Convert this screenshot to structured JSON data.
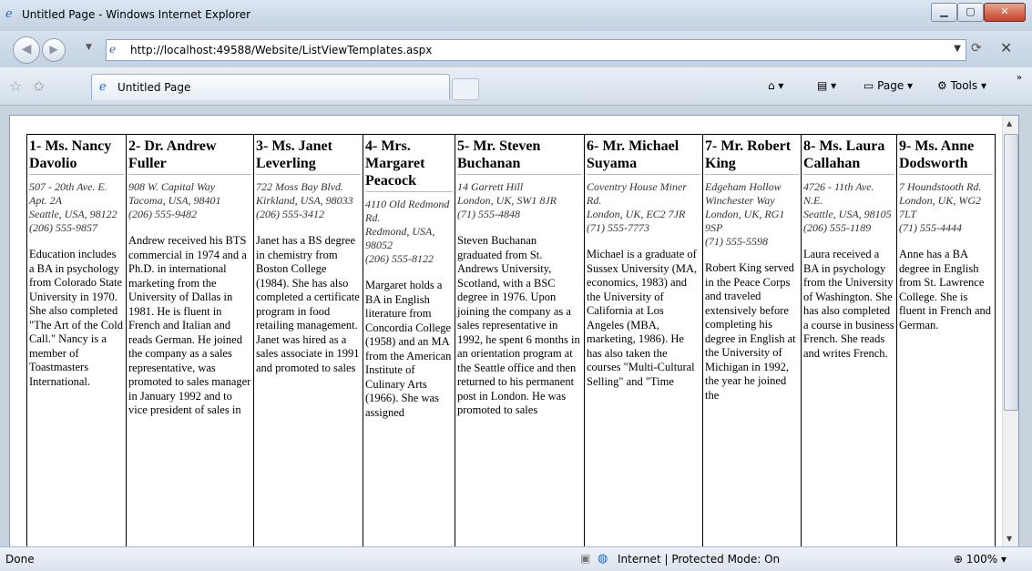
{
  "window": {
    "title": "Untitled Page - Windows Internet Explorer",
    "minimize_icon": "minimize-icon",
    "maximize_icon": "maximize-icon",
    "close_icon": "close-icon"
  },
  "nav": {
    "url": "http://localhost:49588/Website/ListViewTemplates.aspx"
  },
  "tabbar": {
    "tab_title": "Untitled Page",
    "page_label": "Page",
    "tools_label": "Tools"
  },
  "employees": [
    {
      "name": "1- Ms. Nancy Davolio",
      "address": [
        "507 - 20th Ave. E. Apt. 2A",
        "Seattle, USA, 98122",
        "(206) 555-9857"
      ],
      "notes": "Education includes a BA in psychology from Colorado State University in 1970. She also completed \"The Art of the Cold Call.\" Nancy is a member of Toastmasters International."
    },
    {
      "name": "2- Dr. Andrew Fuller",
      "address": [
        "908 W. Capital Way",
        "Tacoma, USA, 98401",
        "(206) 555-9482"
      ],
      "notes": "Andrew received his BTS commercial in 1974 and a Ph.D. in international marketing from the University of Dallas in 1981. He is fluent in French and Italian and reads German. He joined the company as a sales representative, was promoted to sales manager in January 1992 and to vice president of sales in"
    },
    {
      "name": "3- Ms. Janet Leverling",
      "address": [
        "722 Moss Bay Blvd.",
        "Kirkland, USA, 98033",
        "(206) 555-3412"
      ],
      "notes": "Janet has a BS degree in chemistry from Boston College (1984). She has also completed a certificate program in food retailing management. Janet was hired as a sales associate in 1991 and promoted to sales"
    },
    {
      "name": "4- Mrs. Margaret Peacock",
      "address": [
        "4110 Old Redmond Rd.",
        "Redmond, USA, 98052",
        "(206) 555-8122"
      ],
      "notes": "Margaret holds a BA in English literature from Concordia College (1958) and an MA from the American Institute of Culinary Arts (1966). She was assigned"
    },
    {
      "name": "5- Mr. Steven Buchanan",
      "address": [
        "14 Garrett Hill",
        "London, UK, SW1 8JR",
        "(71) 555-4848"
      ],
      "notes": "Steven Buchanan graduated from St. Andrews University, Scotland, with a BSC degree in 1976. Upon joining the company as a sales representative in 1992, he spent 6 months in an orientation program at the Seattle office and then returned to his permanent post in London. He was promoted to sales"
    },
    {
      "name": "6- Mr. Michael Suyama",
      "address": [
        "Coventry House Miner Rd.",
        "London, UK, EC2 7JR",
        "(71) 555-7773"
      ],
      "notes": "Michael is a graduate of Sussex University (MA, economics, 1983) and the University of California at Los Angeles (MBA, marketing, 1986). He has also taken the courses \"Multi-Cultural Selling\" and \"Time"
    },
    {
      "name": "7- Mr. Robert King",
      "address": [
        "Edgeham Hollow Winchester Way",
        "London, UK, RG1 9SP",
        "(71) 555-5598"
      ],
      "notes": "Robert King served in the Peace Corps and traveled extensively before completing his degree in English at the University of Michigan in 1992, the year he joined the"
    },
    {
      "name": "8- Ms. Laura Callahan",
      "address": [
        "4726 - 11th Ave. N.E.",
        "Seattle, USA, 98105",
        "(206) 555-1189"
      ],
      "notes": "Laura received a BA in psychology from the University of Washington. She has also completed a course in business French. She reads and writes French."
    },
    {
      "name": "9- Ms. Anne Dodsworth",
      "address": [
        "7 Houndstooth Rd.",
        "London, UK, WG2 7LT",
        "(71) 555-4444"
      ],
      "notes": "Anne has a BA degree in English from St. Lawrence College. She is fluent in French and German."
    }
  ],
  "status": {
    "left": "Done",
    "zone": "Internet | Protected Mode: On",
    "zoom": "100%"
  }
}
